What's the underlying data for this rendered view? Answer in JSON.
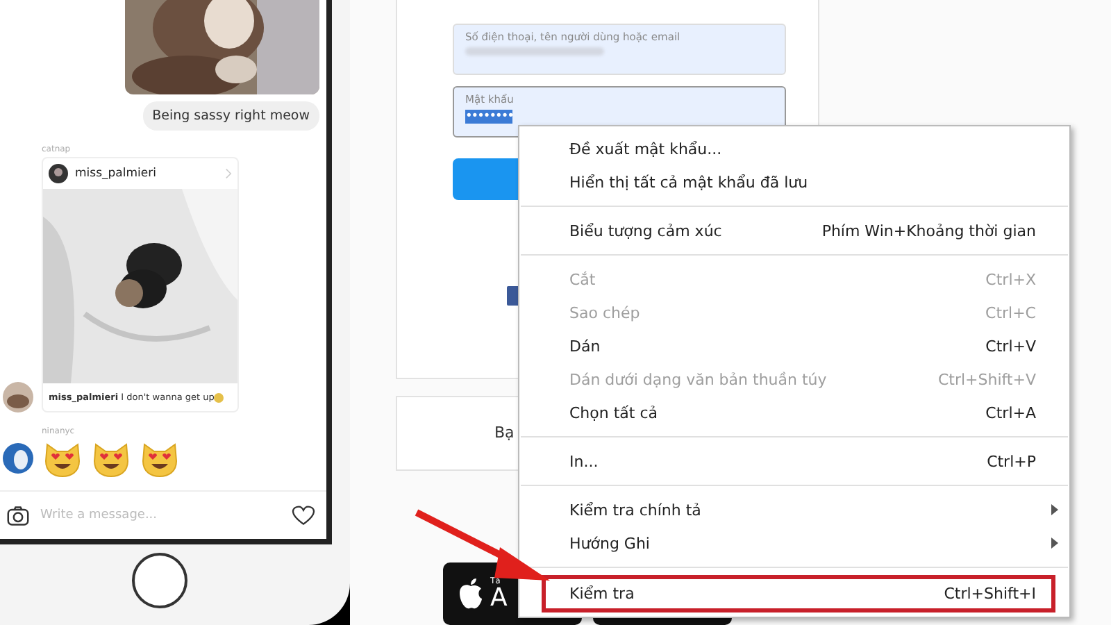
{
  "chat": {
    "messages": [
      {
        "kind": "picture"
      },
      {
        "kind": "bubble",
        "text": "Being sassy right meow"
      },
      {
        "kind": "label",
        "text": "catnap"
      },
      {
        "kind": "post",
        "username": "miss_palmieri",
        "caption_user": "miss_palmieri",
        "caption": "I don't wanna get up"
      },
      {
        "kind": "label",
        "text": "ninanyc"
      },
      {
        "kind": "reaction"
      }
    ],
    "composer": {
      "placeholder": "Write a message..."
    }
  },
  "login": {
    "fields": [
      {
        "label": "Số điện thoại, tên người dùng hoặc email",
        "highlighted": false
      },
      {
        "label": "Mật khẩu",
        "value": "••••••••",
        "highlighted": true
      }
    ]
  },
  "signup_card": {
    "text": "Bạ"
  },
  "app_badge": {
    "small_text": "Tả",
    "text": "A"
  },
  "context_menu": {
    "items": [
      {
        "kind": "item",
        "label": "Đề xuất mật khẩu...",
        "disabled": false,
        "submenu": false,
        "annotated": false
      },
      {
        "kind": "item",
        "label": "Hiển thị tất cả mật khẩu đã lưu",
        "disabled": false,
        "submenu": false,
        "annotated": false
      },
      {
        "kind": "separator"
      },
      {
        "kind": "item",
        "label": "Biểu tượng cảm xúc",
        "shortcut": "Phím Win+Khoảng thời gian",
        "disabled": false,
        "submenu": false,
        "annotated": false
      },
      {
        "kind": "separator"
      },
      {
        "kind": "item",
        "label": "Cắt",
        "shortcut": "Ctrl+X",
        "disabled": true,
        "submenu": false,
        "annotated": false
      },
      {
        "kind": "item",
        "label": "Sao chép",
        "shortcut": "Ctrl+C",
        "disabled": true,
        "submenu": false,
        "annotated": false
      },
      {
        "kind": "item",
        "label": "Dán",
        "shortcut": "Ctrl+V",
        "disabled": false,
        "submenu": false,
        "annotated": false
      },
      {
        "kind": "item",
        "label": "Dán dưới dạng văn bản thuần túy",
        "shortcut": "Ctrl+Shift+V",
        "disabled": true,
        "submenu": false,
        "annotated": false
      },
      {
        "kind": "item",
        "label": "Chọn tất cả",
        "shortcut": "Ctrl+A",
        "disabled": false,
        "submenu": false,
        "annotated": false
      },
      {
        "kind": "separator"
      },
      {
        "kind": "item",
        "label": "In...",
        "shortcut": "Ctrl+P",
        "disabled": false,
        "submenu": false,
        "annotated": false
      },
      {
        "kind": "separator"
      },
      {
        "kind": "item",
        "label": "Kiểm tra chính tả",
        "disabled": false,
        "submenu": true,
        "annotated": false
      },
      {
        "kind": "item",
        "label": "Hướng Ghi",
        "disabled": false,
        "submenu": true,
        "annotated": false
      },
      {
        "kind": "separator"
      },
      {
        "kind": "item",
        "label": "Kiểm tra",
        "shortcut": "Ctrl+Shift+I",
        "disabled": false,
        "submenu": false,
        "annotated": true
      }
    ]
  },
  "annotation": {
    "kind": "arrow"
  }
}
